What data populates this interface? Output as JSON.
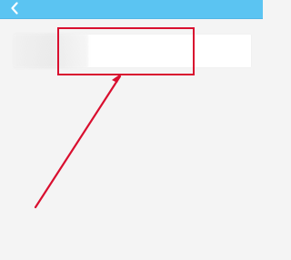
{
  "navbar": {
    "title": "",
    "back_icon": "chevron-left-icon",
    "background": "#5bc4f2"
  },
  "search": {
    "placeholder": ""
  },
  "annotation": {
    "highlight_color": "#d90f2f",
    "arrow_color": "#d90f2f"
  }
}
